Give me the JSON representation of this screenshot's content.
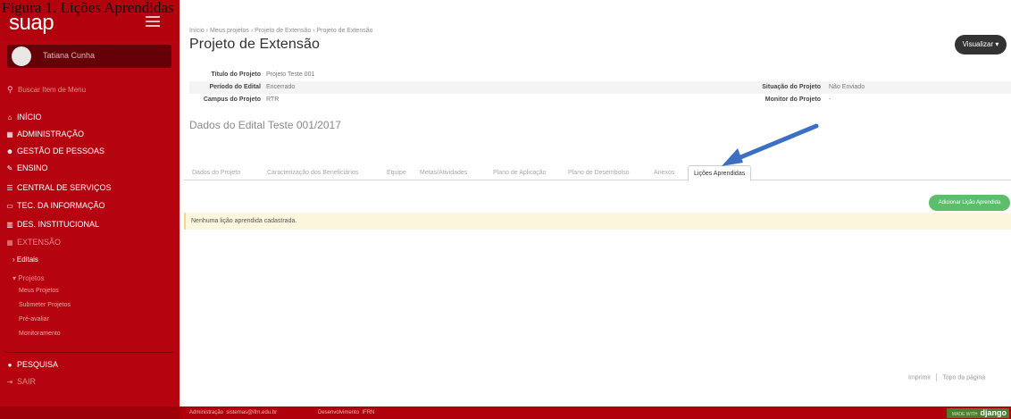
{
  "caption": "Figura 1. Lições Aprendidas",
  "sidebar": {
    "brand": "suap",
    "user_name": "Tatiana Cunha",
    "search_placeholder": "Buscar Item de Menu",
    "nav": [
      {
        "label": "Início",
        "icon": "home-icon",
        "glyph": "⌂"
      },
      {
        "label": "Administração",
        "icon": "grid-icon",
        "glyph": "▦"
      },
      {
        "label": "Gestão de Pessoas",
        "icon": "users-icon",
        "glyph": "☻"
      },
      {
        "label": "Ensino",
        "icon": "pencil-icon",
        "glyph": "✎"
      },
      {
        "label": "Central de Serviços",
        "icon": "list-icon",
        "glyph": "☰"
      },
      {
        "label": "Tec. da Informação",
        "icon": "monitor-icon",
        "glyph": "▭"
      },
      {
        "label": "Des. Institucional",
        "icon": "chart-icon",
        "glyph": "▥"
      },
      {
        "label": "Extensão",
        "icon": "grid-icon",
        "glyph": "▦"
      }
    ],
    "extensao_sub": {
      "editais": "Editais",
      "projetos": "Projetos",
      "projetos_sub": [
        "Meus Projetos",
        "Submeter Projetos",
        "Pré-avaliar",
        "Monitoramento"
      ]
    },
    "pesquisa": {
      "label": "Pesquisa",
      "icon": "search-circle-icon",
      "glyph": "●"
    },
    "sair": {
      "label": "Sair",
      "icon": "exit-icon",
      "glyph": "⇥"
    }
  },
  "breadcrumb": [
    "Início",
    "Meus projetos",
    "Projeto de Extensão",
    "Projeto de Extensão"
  ],
  "page_title": "Projeto de Extensão",
  "visualizar_label": "Visualizar ▾",
  "info": {
    "rows": [
      {
        "label": "Título do Projeto",
        "value": "Projeto Teste 001"
      },
      {
        "label": "Período do Edital",
        "value": "Encerrado",
        "label2": "Situação do Projeto",
        "value2": "Não Enviado"
      },
      {
        "label": "Campus do Projeto",
        "value": "RTR",
        "label2": "Monitor do Projeto",
        "value2": "-"
      }
    ]
  },
  "section_title": "Dados do Edital Teste 001/2017",
  "tabs": [
    {
      "label": "Dados do Projeto"
    },
    {
      "label": "Caracterização dos Beneficiários"
    },
    {
      "label": "Equipe"
    },
    {
      "label": "Metas/Atividades"
    },
    {
      "label": "Plano de Aplicação"
    },
    {
      "label": "Plano de Desembolso"
    },
    {
      "label": "Anexos"
    },
    {
      "label": "Lições Aprendidas",
      "active": true
    }
  ],
  "add_button_label": "Adicionar Lição Aprendida",
  "alert_text": "Nenhuma lição aprendida cadastrada.",
  "bottom_links": {
    "print": "Imprimir",
    "top": "Topo da página"
  },
  "footer": {
    "admin_label": "Administração",
    "admin_email": "sistemas@ifrn.edu.br",
    "dev_label": "Desenvolvimento",
    "dev_value": "IFRN",
    "badge_small": "MADE WITH",
    "badge_big": "django"
  },
  "colors": {
    "sidebar": "#b5030f",
    "arrow": "#3a6fc4",
    "success": "#5cbd6b"
  }
}
